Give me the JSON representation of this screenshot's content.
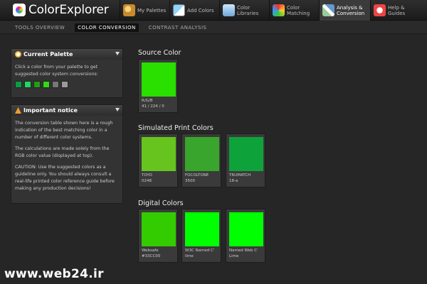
{
  "app": {
    "logo_text": "ColorExplorer"
  },
  "nav_tabs": [
    {
      "label": "My Palettes",
      "icon": "palette-icon"
    },
    {
      "label": "Add Colors",
      "icon": "add-colors-icon"
    },
    {
      "label": "Color Libraries",
      "icon": "library-icon"
    },
    {
      "label": "Color Matching",
      "icon": "color-wheel-icon"
    },
    {
      "label": "Analysis & Conversion",
      "icon": "analysis-icon",
      "active": true
    },
    {
      "label": "Help & Guides",
      "icon": "lifebuoy-icon"
    }
  ],
  "sub_tabs": [
    {
      "label": "TOOLS OVERVIEW"
    },
    {
      "label": "COLOR CONVERSION",
      "active": true
    },
    {
      "label": "CONTRAST ANALYSIS"
    }
  ],
  "current_palette": {
    "title": "Current Palette",
    "text": "Click a color from your palette to get suggested color system conversions:",
    "swatches": [
      "#0a9c45",
      "#1fd660",
      "#239c17",
      "#2edc10",
      "#777777",
      "#9a9a9a"
    ]
  },
  "notice": {
    "title": "Important notice",
    "p1": "The conversion table shown here is a rough indication of the best matching color in a number of different color systems.",
    "p2": "The calculations are made solely from the RGB color value (displayed at top).",
    "p3": "CAUTION: Use the suggested colors as a guideline only. You should always consult a real-life printed color reference guide before making any production decisions!"
  },
  "source": {
    "title": "Source Color",
    "card": {
      "line1": "R/G/B",
      "line2": "41 / 224 / 0",
      "color": "#29e000"
    }
  },
  "print": {
    "title": "Simulated Print Colors",
    "cards": [
      {
        "line1": "TOYO",
        "line2": "0248",
        "color": "#67c41e"
      },
      {
        "line1": "FOCOLTONE",
        "line2": "3500",
        "color": "#3aa52c"
      },
      {
        "line1": "TRUMATCH",
        "line2": "18-a",
        "color": "#0ea33a"
      }
    ]
  },
  "digital": {
    "title": "Digital Colors",
    "cards": [
      {
        "line1": "Websafe",
        "line2": "#33CC00",
        "color": "#33cc00"
      },
      {
        "line1": "W3C Named C'",
        "line2": "lime",
        "color": "#00ff00"
      },
      {
        "line1": "Named Web C'",
        "line2": "Lime",
        "color": "#00ff00"
      }
    ]
  },
  "watermark": "www.web24.ir"
}
